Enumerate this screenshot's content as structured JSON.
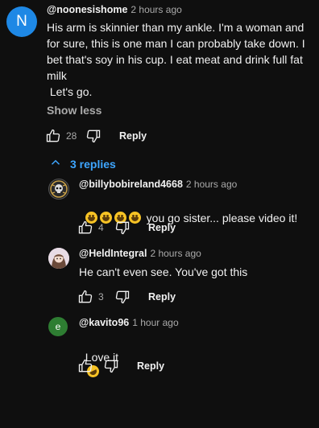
{
  "comment": {
    "avatar_letter": "N",
    "avatar_color": "#1e88e5",
    "author": "@noonesishome",
    "time": "2 hours ago",
    "text": "His arm is skinnier than my ankle. I'm a woman and for sure, this is one man I can probably take down. I bet that's soy in his cup. I eat meat and drink full fat milk\n Let's go.",
    "show_less": "Show less",
    "likes": "28",
    "reply_label": "Reply",
    "replies_toggle": "3 replies"
  },
  "replies": [
    {
      "author": "@billybobireland4668",
      "time": "2 hours ago",
      "text": "you go sister... please video it!",
      "emoji_count": 4,
      "likes": "4",
      "reply_label": "Reply"
    },
    {
      "author": "@HeldIntegral",
      "time": "2 hours ago",
      "text": "He can't even see. You've got this",
      "likes": "3",
      "reply_label": "Reply"
    },
    {
      "author": "@kavito96",
      "avatar_letter": "e",
      "avatar_color": "#2e7d32",
      "time": "1 hour ago",
      "text": "Love it",
      "likes": "",
      "reply_label": "Reply"
    }
  ],
  "colors": {
    "background": "#0f0f0f",
    "link": "#3ea6ff",
    "muted": "#aaaaaa"
  }
}
